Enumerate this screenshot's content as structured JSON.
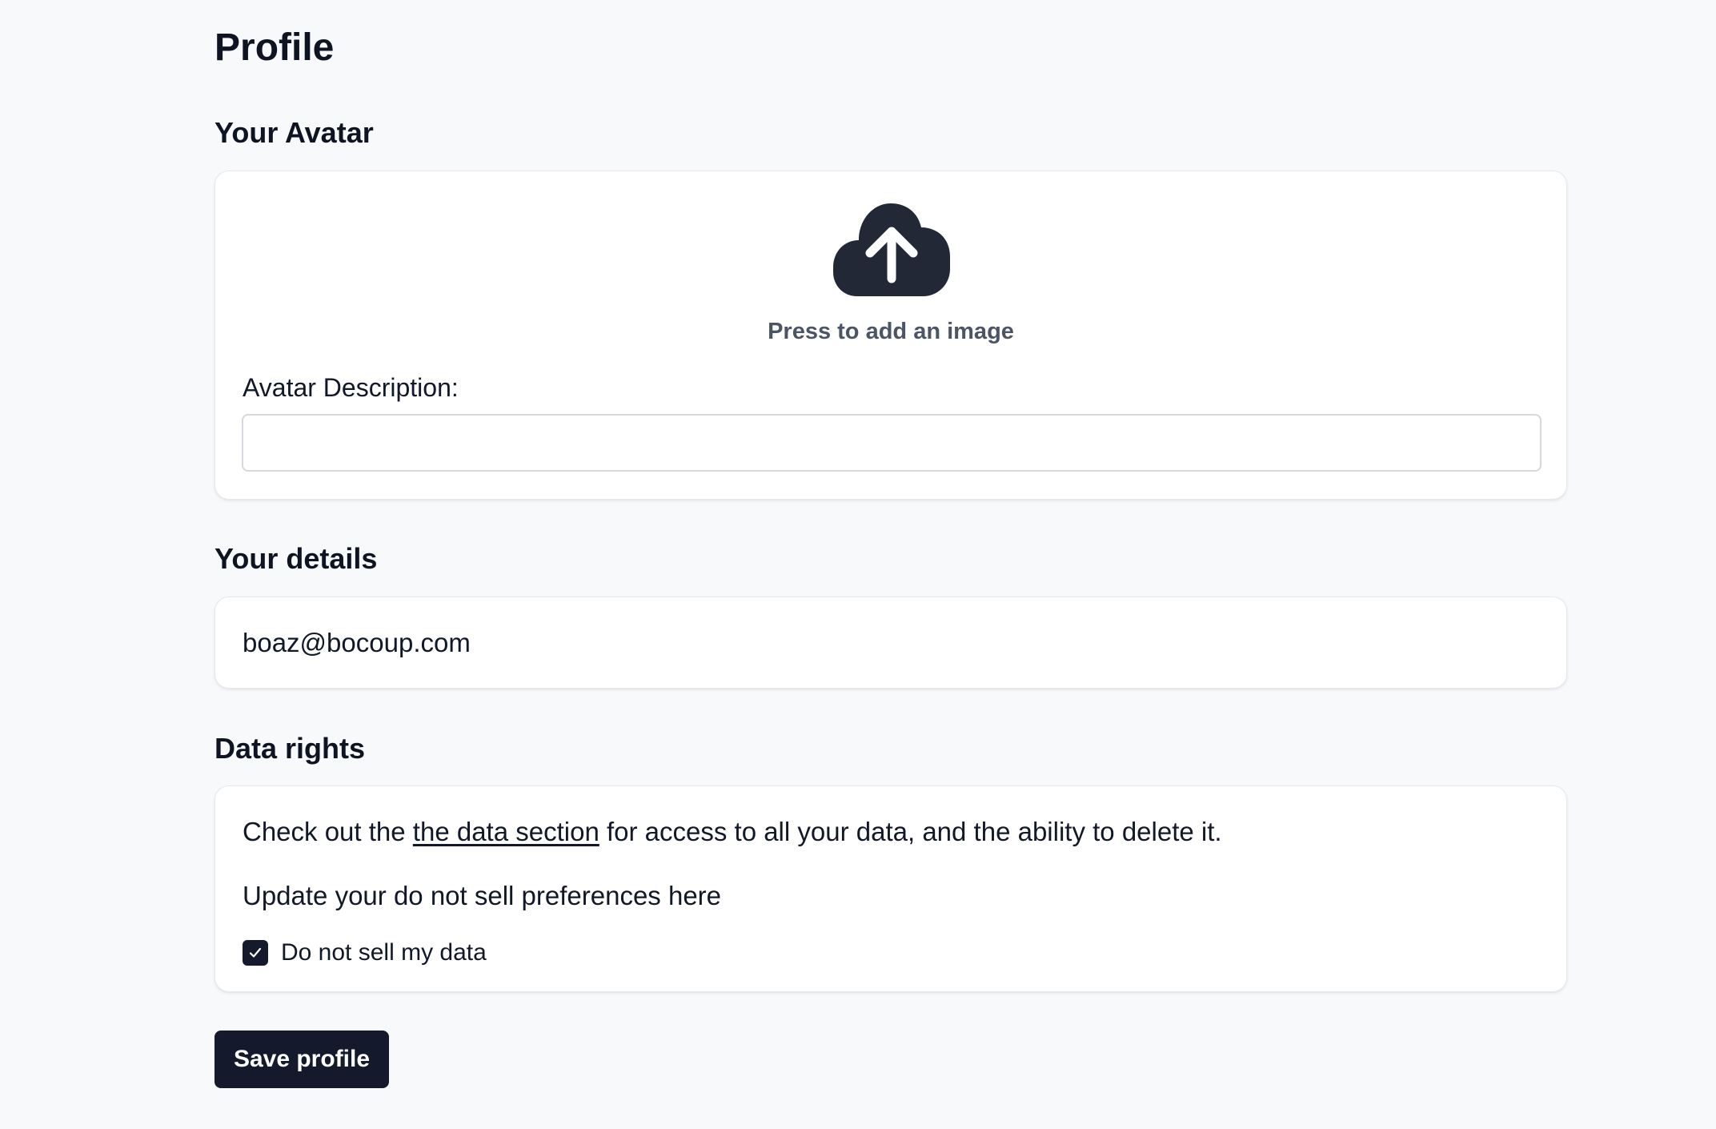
{
  "page": {
    "title": "Profile"
  },
  "avatar": {
    "heading": "Your Avatar",
    "upload_icon": "cloud-upload-icon",
    "upload_text": "Press to add an image",
    "description_label": "Avatar Description:",
    "description_value": "",
    "description_placeholder": ""
  },
  "details": {
    "heading": "Your details",
    "email": "boaz@bocoup.com"
  },
  "data_rights": {
    "heading": "Data rights",
    "text_before_link": "Check out the ",
    "link_text": "the data section",
    "text_after_link": " for access to all your data, and the ability to delete it.",
    "preferences_text": "Update your do not sell preferences here",
    "checkbox_label": "Do not sell my data",
    "checkbox_checked": true,
    "checkbox_icon": "check-icon"
  },
  "actions": {
    "save_label": "Save profile"
  },
  "colors": {
    "background": "#f8f9fb",
    "card": "#ffffff",
    "primary": "#141a2b",
    "icon": "#222836",
    "muted_text": "#4b5565"
  }
}
